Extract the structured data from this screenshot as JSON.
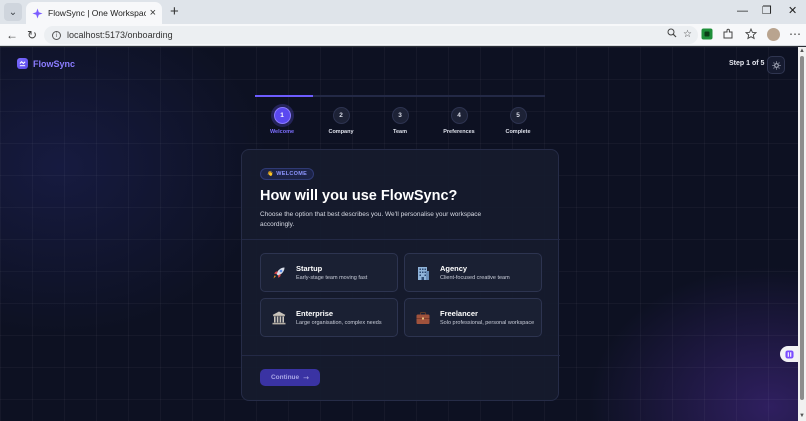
{
  "browser": {
    "tab_title": "FlowSync | One Workspace. Every",
    "url": "localhost:5173/onboarding"
  },
  "app": {
    "logo_text": "FlowSync",
    "step_indicator": "Step 1 of 5",
    "accent_color": "#6d5cff"
  },
  "stepper": {
    "progress": 0.2,
    "steps": [
      {
        "number": "1",
        "label": "Welcome",
        "active": true
      },
      {
        "number": "2",
        "label": "Company",
        "active": false
      },
      {
        "number": "3",
        "label": "Team",
        "active": false
      },
      {
        "number": "4",
        "label": "Preferences",
        "active": false
      },
      {
        "number": "5",
        "label": "Complete",
        "active": false
      }
    ]
  },
  "card": {
    "badge": "WELCOME",
    "title": "How will you use FlowSync?",
    "subtitle": "Choose the option that best describes you. We'll personalise your workspace accordingly.",
    "options": [
      {
        "name": "Startup",
        "description": "Early-stage team moving fast",
        "icon": "rocket-icon"
      },
      {
        "name": "Agency",
        "description": "Client-focused creative team",
        "icon": "office-building-icon"
      },
      {
        "name": "Enterprise",
        "description": "Large organisation, complex needs",
        "icon": "classical-building-icon"
      },
      {
        "name": "Freelancer",
        "description": "Solo professional, personal workspace",
        "icon": "briefcase-icon"
      }
    ],
    "continue_label": "Continue"
  }
}
